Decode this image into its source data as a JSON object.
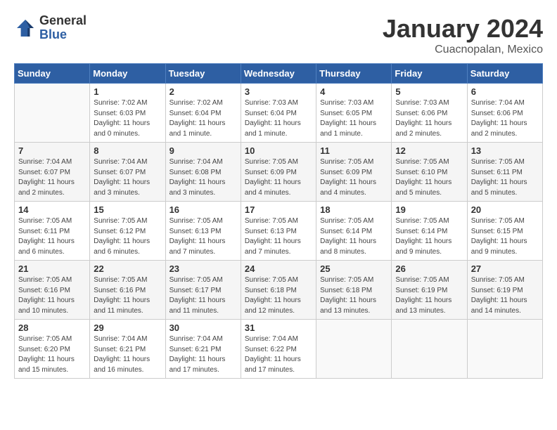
{
  "header": {
    "logo_general": "General",
    "logo_blue": "Blue",
    "month_title": "January 2024",
    "location": "Cuacnopalan, Mexico"
  },
  "days_of_week": [
    "Sunday",
    "Monday",
    "Tuesday",
    "Wednesday",
    "Thursday",
    "Friday",
    "Saturday"
  ],
  "weeks": [
    [
      {
        "day": "",
        "sunrise": "",
        "sunset": "",
        "daylight": ""
      },
      {
        "day": "1",
        "sunrise": "Sunrise: 7:02 AM",
        "sunset": "Sunset: 6:03 PM",
        "daylight": "Daylight: 11 hours and 0 minutes."
      },
      {
        "day": "2",
        "sunrise": "Sunrise: 7:02 AM",
        "sunset": "Sunset: 6:04 PM",
        "daylight": "Daylight: 11 hours and 1 minute."
      },
      {
        "day": "3",
        "sunrise": "Sunrise: 7:03 AM",
        "sunset": "Sunset: 6:04 PM",
        "daylight": "Daylight: 11 hours and 1 minute."
      },
      {
        "day": "4",
        "sunrise": "Sunrise: 7:03 AM",
        "sunset": "Sunset: 6:05 PM",
        "daylight": "Daylight: 11 hours and 1 minute."
      },
      {
        "day": "5",
        "sunrise": "Sunrise: 7:03 AM",
        "sunset": "Sunset: 6:06 PM",
        "daylight": "Daylight: 11 hours and 2 minutes."
      },
      {
        "day": "6",
        "sunrise": "Sunrise: 7:04 AM",
        "sunset": "Sunset: 6:06 PM",
        "daylight": "Daylight: 11 hours and 2 minutes."
      }
    ],
    [
      {
        "day": "7",
        "sunrise": "Sunrise: 7:04 AM",
        "sunset": "Sunset: 6:07 PM",
        "daylight": "Daylight: 11 hours and 2 minutes."
      },
      {
        "day": "8",
        "sunrise": "Sunrise: 7:04 AM",
        "sunset": "Sunset: 6:07 PM",
        "daylight": "Daylight: 11 hours and 3 minutes."
      },
      {
        "day": "9",
        "sunrise": "Sunrise: 7:04 AM",
        "sunset": "Sunset: 6:08 PM",
        "daylight": "Daylight: 11 hours and 3 minutes."
      },
      {
        "day": "10",
        "sunrise": "Sunrise: 7:05 AM",
        "sunset": "Sunset: 6:09 PM",
        "daylight": "Daylight: 11 hours and 4 minutes."
      },
      {
        "day": "11",
        "sunrise": "Sunrise: 7:05 AM",
        "sunset": "Sunset: 6:09 PM",
        "daylight": "Daylight: 11 hours and 4 minutes."
      },
      {
        "day": "12",
        "sunrise": "Sunrise: 7:05 AM",
        "sunset": "Sunset: 6:10 PM",
        "daylight": "Daylight: 11 hours and 5 minutes."
      },
      {
        "day": "13",
        "sunrise": "Sunrise: 7:05 AM",
        "sunset": "Sunset: 6:11 PM",
        "daylight": "Daylight: 11 hours and 5 minutes."
      }
    ],
    [
      {
        "day": "14",
        "sunrise": "Sunrise: 7:05 AM",
        "sunset": "Sunset: 6:11 PM",
        "daylight": "Daylight: 11 hours and 6 minutes."
      },
      {
        "day": "15",
        "sunrise": "Sunrise: 7:05 AM",
        "sunset": "Sunset: 6:12 PM",
        "daylight": "Daylight: 11 hours and 6 minutes."
      },
      {
        "day": "16",
        "sunrise": "Sunrise: 7:05 AM",
        "sunset": "Sunset: 6:13 PM",
        "daylight": "Daylight: 11 hours and 7 minutes."
      },
      {
        "day": "17",
        "sunrise": "Sunrise: 7:05 AM",
        "sunset": "Sunset: 6:13 PM",
        "daylight": "Daylight: 11 hours and 7 minutes."
      },
      {
        "day": "18",
        "sunrise": "Sunrise: 7:05 AM",
        "sunset": "Sunset: 6:14 PM",
        "daylight": "Daylight: 11 hours and 8 minutes."
      },
      {
        "day": "19",
        "sunrise": "Sunrise: 7:05 AM",
        "sunset": "Sunset: 6:14 PM",
        "daylight": "Daylight: 11 hours and 9 minutes."
      },
      {
        "day": "20",
        "sunrise": "Sunrise: 7:05 AM",
        "sunset": "Sunset: 6:15 PM",
        "daylight": "Daylight: 11 hours and 9 minutes."
      }
    ],
    [
      {
        "day": "21",
        "sunrise": "Sunrise: 7:05 AM",
        "sunset": "Sunset: 6:16 PM",
        "daylight": "Daylight: 11 hours and 10 minutes."
      },
      {
        "day": "22",
        "sunrise": "Sunrise: 7:05 AM",
        "sunset": "Sunset: 6:16 PM",
        "daylight": "Daylight: 11 hours and 11 minutes."
      },
      {
        "day": "23",
        "sunrise": "Sunrise: 7:05 AM",
        "sunset": "Sunset: 6:17 PM",
        "daylight": "Daylight: 11 hours and 11 minutes."
      },
      {
        "day": "24",
        "sunrise": "Sunrise: 7:05 AM",
        "sunset": "Sunset: 6:18 PM",
        "daylight": "Daylight: 11 hours and 12 minutes."
      },
      {
        "day": "25",
        "sunrise": "Sunrise: 7:05 AM",
        "sunset": "Sunset: 6:18 PM",
        "daylight": "Daylight: 11 hours and 13 minutes."
      },
      {
        "day": "26",
        "sunrise": "Sunrise: 7:05 AM",
        "sunset": "Sunset: 6:19 PM",
        "daylight": "Daylight: 11 hours and 13 minutes."
      },
      {
        "day": "27",
        "sunrise": "Sunrise: 7:05 AM",
        "sunset": "Sunset: 6:19 PM",
        "daylight": "Daylight: 11 hours and 14 minutes."
      }
    ],
    [
      {
        "day": "28",
        "sunrise": "Sunrise: 7:05 AM",
        "sunset": "Sunset: 6:20 PM",
        "daylight": "Daylight: 11 hours and 15 minutes."
      },
      {
        "day": "29",
        "sunrise": "Sunrise: 7:04 AM",
        "sunset": "Sunset: 6:21 PM",
        "daylight": "Daylight: 11 hours and 16 minutes."
      },
      {
        "day": "30",
        "sunrise": "Sunrise: 7:04 AM",
        "sunset": "Sunset: 6:21 PM",
        "daylight": "Daylight: 11 hours and 17 minutes."
      },
      {
        "day": "31",
        "sunrise": "Sunrise: 7:04 AM",
        "sunset": "Sunset: 6:22 PM",
        "daylight": "Daylight: 11 hours and 17 minutes."
      },
      {
        "day": "",
        "sunrise": "",
        "sunset": "",
        "daylight": ""
      },
      {
        "day": "",
        "sunrise": "",
        "sunset": "",
        "daylight": ""
      },
      {
        "day": "",
        "sunrise": "",
        "sunset": "",
        "daylight": ""
      }
    ]
  ]
}
